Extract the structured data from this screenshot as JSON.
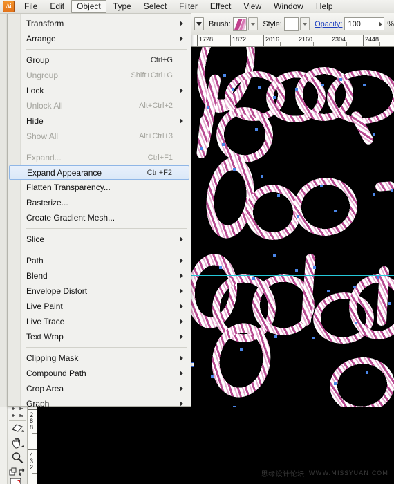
{
  "app": {
    "name": "Adobe Illustrator",
    "logo_text": "Ai"
  },
  "menubar": {
    "items": [
      {
        "label": "File",
        "mnemonic": "F",
        "active": false
      },
      {
        "label": "Edit",
        "mnemonic": "E",
        "active": false
      },
      {
        "label": "Object",
        "mnemonic": "O",
        "active": true
      },
      {
        "label": "Type",
        "mnemonic": "T",
        "active": false
      },
      {
        "label": "Select",
        "mnemonic": "S",
        "active": false
      },
      {
        "label": "Filter",
        "mnemonic": "l",
        "active": false
      },
      {
        "label": "Effect",
        "mnemonic": "c",
        "active": false
      },
      {
        "label": "View",
        "mnemonic": "V",
        "active": false
      },
      {
        "label": "Window",
        "mnemonic": "W",
        "active": false
      },
      {
        "label": "Help",
        "mnemonic": "H",
        "active": false
      }
    ]
  },
  "control_bar": {
    "brush_label": "Brush:",
    "style_label": "Style:",
    "opacity_label": "Opacity:",
    "opacity_value": "100",
    "percent_symbol": "%"
  },
  "object_menu": {
    "entries": [
      {
        "label": "Transform",
        "shortcut": "",
        "submenu": true,
        "disabled": false,
        "selected": false
      },
      {
        "label": "Arrange",
        "shortcut": "",
        "submenu": true,
        "disabled": false,
        "selected": false
      },
      {
        "separator": true
      },
      {
        "label": "Group",
        "shortcut": "Ctrl+G",
        "submenu": false,
        "disabled": false,
        "selected": false
      },
      {
        "label": "Ungroup",
        "shortcut": "Shift+Ctrl+G",
        "submenu": false,
        "disabled": true,
        "selected": false
      },
      {
        "label": "Lock",
        "shortcut": "",
        "submenu": true,
        "disabled": false,
        "selected": false
      },
      {
        "label": "Unlock All",
        "shortcut": "Alt+Ctrl+2",
        "submenu": false,
        "disabled": true,
        "selected": false
      },
      {
        "label": "Hide",
        "shortcut": "",
        "submenu": true,
        "disabled": false,
        "selected": false
      },
      {
        "label": "Show All",
        "shortcut": "Alt+Ctrl+3",
        "submenu": false,
        "disabled": true,
        "selected": false
      },
      {
        "separator": true
      },
      {
        "label": "Expand...",
        "shortcut": "Ctrl+F1",
        "submenu": false,
        "disabled": true,
        "selected": false
      },
      {
        "label": "Expand Appearance",
        "shortcut": "Ctrl+F2",
        "submenu": false,
        "disabled": false,
        "selected": true
      },
      {
        "label": "Flatten Transparency...",
        "shortcut": "",
        "submenu": false,
        "disabled": false,
        "selected": false
      },
      {
        "label": "Rasterize...",
        "shortcut": "",
        "submenu": false,
        "disabled": false,
        "selected": false
      },
      {
        "label": "Create Gradient Mesh...",
        "shortcut": "",
        "submenu": false,
        "disabled": false,
        "selected": false
      },
      {
        "separator": true
      },
      {
        "label": "Slice",
        "shortcut": "",
        "submenu": true,
        "disabled": false,
        "selected": false
      },
      {
        "separator": true
      },
      {
        "label": "Path",
        "shortcut": "",
        "submenu": true,
        "disabled": false,
        "selected": false
      },
      {
        "label": "Blend",
        "shortcut": "",
        "submenu": true,
        "disabled": false,
        "selected": false
      },
      {
        "label": "Envelope Distort",
        "shortcut": "",
        "submenu": true,
        "disabled": false,
        "selected": false
      },
      {
        "label": "Live Paint",
        "shortcut": "",
        "submenu": true,
        "disabled": false,
        "selected": false
      },
      {
        "label": "Live Trace",
        "shortcut": "",
        "submenu": true,
        "disabled": false,
        "selected": false
      },
      {
        "label": "Text Wrap",
        "shortcut": "",
        "submenu": true,
        "disabled": false,
        "selected": false
      },
      {
        "separator": true
      },
      {
        "label": "Clipping Mask",
        "shortcut": "",
        "submenu": true,
        "disabled": false,
        "selected": false
      },
      {
        "label": "Compound Path",
        "shortcut": "",
        "submenu": true,
        "disabled": false,
        "selected": false
      },
      {
        "label": "Crop Area",
        "shortcut": "",
        "submenu": true,
        "disabled": false,
        "selected": false
      },
      {
        "label": "Graph",
        "shortcut": "",
        "submenu": true,
        "disabled": false,
        "selected": false
      }
    ]
  },
  "rulers": {
    "horizontal_labels": [
      "1728",
      "1872",
      "2016",
      "2160",
      "2304",
      "2448"
    ],
    "vertical_labels": [
      "288",
      "432"
    ],
    "units": "pt"
  },
  "tools": [
    {
      "name": "crop-marks-tool",
      "icon": "crop-marks-icon"
    },
    {
      "name": "eraser-tool",
      "icon": "eraser-icon"
    },
    {
      "name": "hand-tool",
      "icon": "hand-icon"
    },
    {
      "name": "zoom-tool",
      "icon": "magnifier-icon"
    },
    {
      "name": "fill-stroke-swap",
      "icon": "swap-arrow-icon"
    },
    {
      "name": "fill-swatch",
      "icon": "fill-icon"
    }
  ],
  "canvas": {
    "background_color": "#000000",
    "artwork_description": "candy-cane striped rope script lettering",
    "rope_colors": [
      "#b84a91",
      "#ffffff",
      "#e6a9cf"
    ],
    "anchor_color": "#4a86e8",
    "guide_color": "#25c8d8",
    "selection_color": "#3a6fe0"
  },
  "watermark": {
    "text_cn": "思缘设计论坛",
    "text_url": "WWW.MISSYUAN.COM"
  }
}
